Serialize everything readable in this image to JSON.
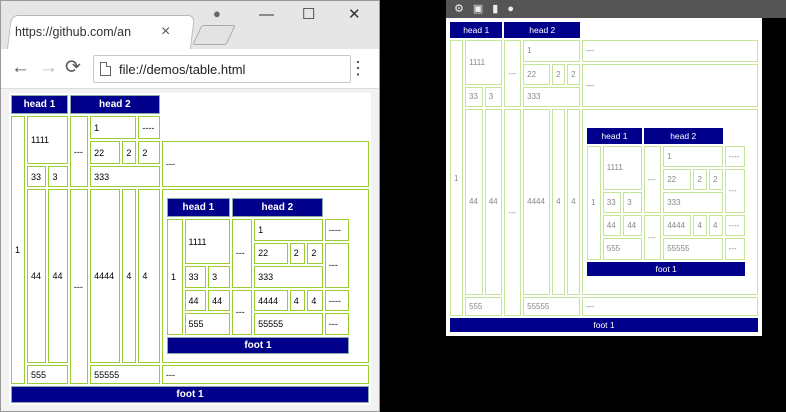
{
  "browser": {
    "tab_title": "https://github.com/an",
    "tab_close": "×",
    "address": "file://demos/table.html",
    "nav": {
      "back": "←",
      "forward": "→",
      "reload": "⟳"
    },
    "window_controls": {
      "minimize": "—",
      "maximize": "☐",
      "close": "✕"
    },
    "menu_glyph": "⋮",
    "profile_glyph": "●"
  },
  "table": {
    "head1": "head 1",
    "head2": "head 2",
    "foot": "foot 1",
    "cells": {
      "c1": "1",
      "c1111": "1111",
      "c33": "33",
      "c3": "3",
      "dash3": "---",
      "c1b": "1",
      "dash4": "----",
      "c22": "22",
      "c2a": "2",
      "c2b": "2",
      "dash3b": "---",
      "c333": "333",
      "c44a": "44",
      "c44b": "44",
      "c4444": "4444",
      "c4a": "4",
      "c4b": "4",
      "c555": "555",
      "c55555": "55555",
      "dash3c": "---"
    },
    "inner": {
      "head1": "head 1",
      "head2": "head 2",
      "foot": "foot 1",
      "c1": "1",
      "c1111": "1111",
      "dash3": "---",
      "c1b": "1",
      "dash4": "----",
      "c22": "22",
      "c2a": "2",
      "c2b": "2",
      "dash3b": "---",
      "c33": "33",
      "c3": "3",
      "c333": "333",
      "c44a": "44",
      "c44b": "44",
      "dash3c": "---",
      "c4444": "4444",
      "c4a": "4",
      "c4b": "4",
      "dash4b": "----",
      "c555": "555",
      "c55555": "55555",
      "dash3d": "---"
    },
    "right_dash2": "—"
  }
}
